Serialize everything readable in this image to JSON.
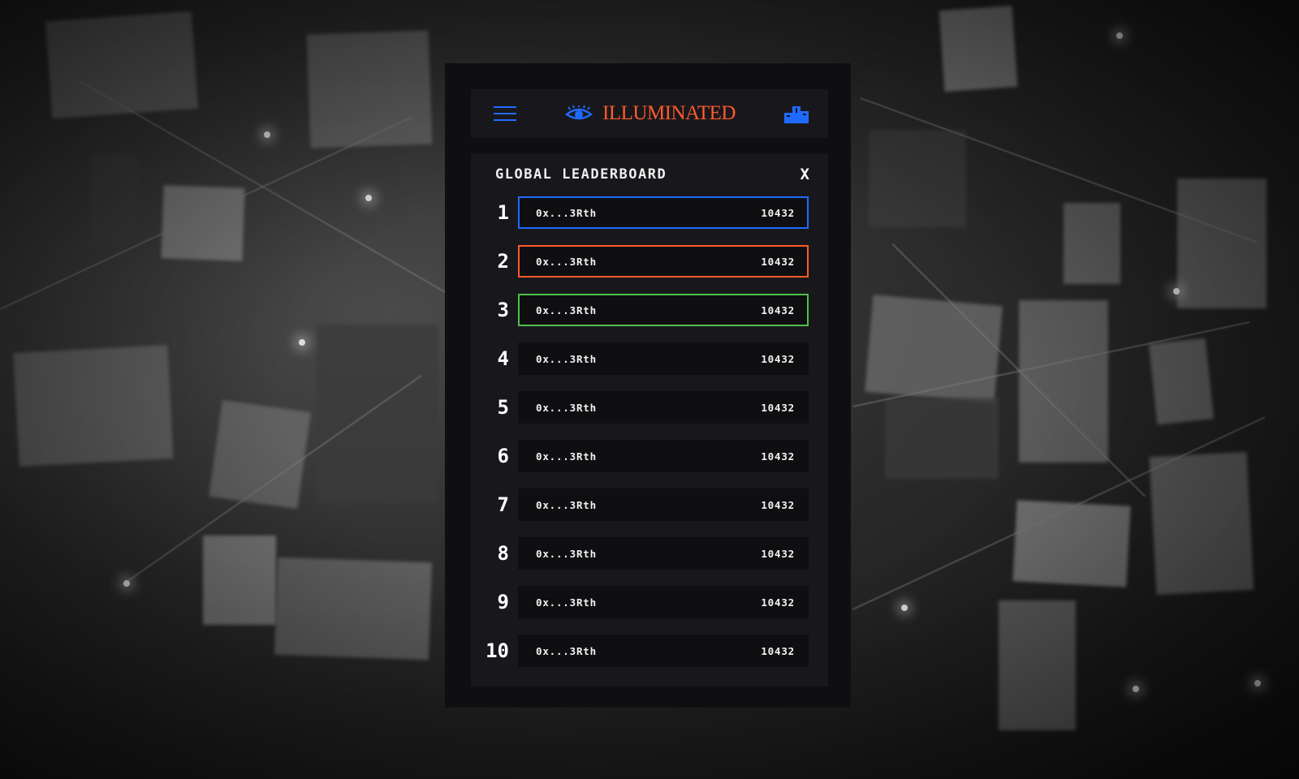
{
  "app": {
    "logo_text": "ILLUMINATED",
    "logo_icon": "eye-icon",
    "menu_icon": "hamburger-menu-icon",
    "leaderboard_icon": "podium-icon"
  },
  "leaderboard": {
    "title": "GLOBAL LEADERBOARD",
    "close_label": "X",
    "rows": [
      {
        "rank": "1",
        "address": "0x...3Rth",
        "score": "10432"
      },
      {
        "rank": "2",
        "address": "0x...3Rth",
        "score": "10432"
      },
      {
        "rank": "3",
        "address": "0x...3Rth",
        "score": "10432"
      },
      {
        "rank": "4",
        "address": "0x...3Rth",
        "score": "10432"
      },
      {
        "rank": "5",
        "address": "0x...3Rth",
        "score": "10432"
      },
      {
        "rank": "6",
        "address": "0x...3Rth",
        "score": "10432"
      },
      {
        "rank": "7",
        "address": "0x...3Rth",
        "score": "10432"
      },
      {
        "rank": "8",
        "address": "0x...3Rth",
        "score": "10432"
      },
      {
        "rank": "9",
        "address": "0x...3Rth",
        "score": "10432"
      },
      {
        "rank": "10",
        "address": "0x...3Rth",
        "score": "10432"
      }
    ]
  },
  "colors": {
    "accent_blue": "#1f6bff",
    "accent_orange": "#ff5a2c",
    "accent_green": "#4fbf4a",
    "panel_bg": "#0f0f12",
    "card_bg": "#18181c"
  }
}
